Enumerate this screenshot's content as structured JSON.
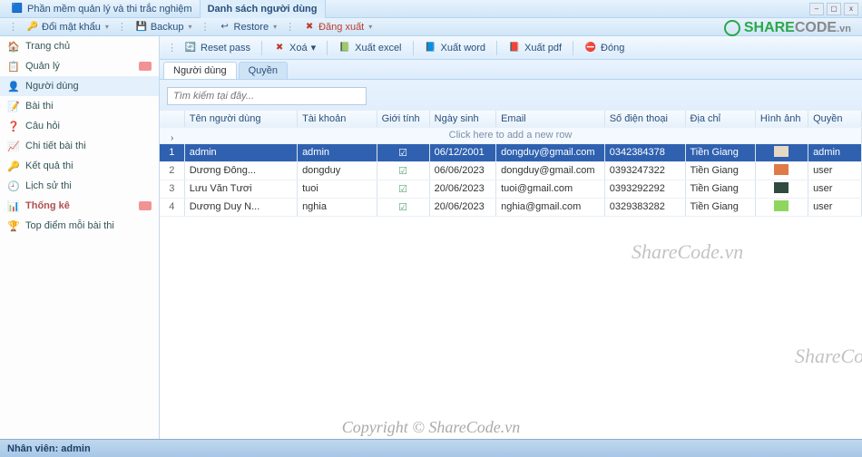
{
  "title_tabs": {
    "main": "Phần mềm quản lý và thi trắc nghiệm",
    "page": "Danh sách người dùng"
  },
  "win_controls": {
    "min": "–",
    "max": "▢",
    "close": "x"
  },
  "menubar": [
    {
      "icon": "🔑",
      "label": "Đổi mật khẩu"
    },
    {
      "icon": "💾",
      "label": "Backup"
    },
    {
      "icon": "↩",
      "label": "Restore"
    },
    {
      "icon": "✖",
      "label": "Đăng xuất",
      "color": "#c0392b"
    }
  ],
  "sidebar": {
    "items": [
      {
        "icon": "🏠",
        "label": "Trang chủ"
      },
      {
        "icon": "📋",
        "label": "Quản lý",
        "badge": true
      },
      {
        "icon": "👤",
        "label": "Người dùng",
        "active": true
      },
      {
        "icon": "📝",
        "label": "Bài thi"
      },
      {
        "icon": "❓",
        "label": "Câu hỏi"
      },
      {
        "icon": "📈",
        "label": "Chi tiết bài thi"
      },
      {
        "icon": "🔑",
        "label": "Kết quả thi"
      },
      {
        "icon": "🕘",
        "label": "Lịch sử thi"
      },
      {
        "icon": "📊",
        "label": "Thống kê",
        "bold": true,
        "badge": true
      },
      {
        "icon": "🏆",
        "label": "Top điểm mỗi bài thi"
      }
    ]
  },
  "toolbar": [
    {
      "icon": "🔄",
      "label": "Reset pass"
    },
    {
      "icon": "✖",
      "label": "Xoá",
      "color": "#c0392b"
    },
    {
      "icon": "📗",
      "label": "Xuất excel"
    },
    {
      "icon": "📘",
      "label": "Xuất word"
    },
    {
      "icon": "📕",
      "label": "Xuất pdf"
    },
    {
      "icon": "⛔",
      "label": "Đóng"
    }
  ],
  "tabs": {
    "t1": "Người dùng",
    "t2": "Quyền"
  },
  "search": {
    "placeholder": "Tìm kiếm tại đây..."
  },
  "grid": {
    "columns": [
      "",
      "Tên người dùng",
      "Tài khoản",
      "Giới tính",
      "Ngày sinh",
      "Email",
      "Số điện thoại",
      "Địa chỉ",
      "Hình ảnh",
      "Quyền"
    ],
    "newrow_label": "Click here to add a new row",
    "rows": [
      {
        "n": "1",
        "ten": "admin",
        "tk": "admin",
        "gt": "✔",
        "ns": "06/12/2001",
        "email": "dongduy@gmail.com",
        "sdt": "0342384378",
        "dc": "Tiền Giang",
        "img": "#e6d9c4",
        "quyen": "admin",
        "selected": true
      },
      {
        "n": "2",
        "ten": "Dương Đông...",
        "tk": "dongduy",
        "gt": "✔",
        "ns": "06/06/2023",
        "email": "dongduy@gmail.com",
        "sdt": "0393247322",
        "dc": "Tiền Giang",
        "img": "#e07a48",
        "quyen": "user"
      },
      {
        "n": "3",
        "ten": "Lưu Văn Tươi",
        "tk": "tuoi",
        "gt": "✔",
        "ns": "20/06/2023",
        "email": "tuoi@gmail.com",
        "sdt": "0393292292",
        "dc": "Tiền Giang",
        "img": "#2f4a3f",
        "quyen": "user"
      },
      {
        "n": "4",
        "ten": "Dương Duy N...",
        "tk": "nghia",
        "gt": "✔",
        "ns": "20/06/2023",
        "email": "nghia@gmail.com",
        "sdt": "0329383282",
        "dc": "Tiền Giang",
        "img": "#8ed65e",
        "quyen": "user"
      }
    ]
  },
  "watermark": "ShareCode.vn",
  "copyright": "Copyright © ShareCode.vn",
  "logo": {
    "t1": "SHARE",
    "t2": "CODE",
    "t3": ".vn"
  },
  "status": {
    "label": "Nhân viên: admin"
  }
}
